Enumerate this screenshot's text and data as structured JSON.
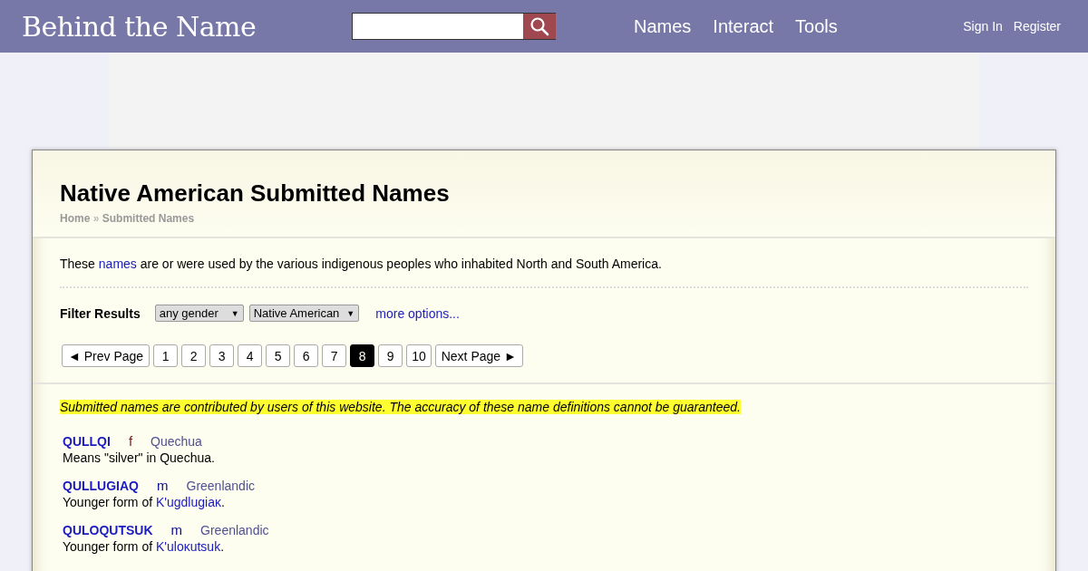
{
  "header": {
    "logo": "Behind the Name",
    "nav": [
      "Names",
      "Interact",
      "Tools"
    ],
    "account": [
      "Sign In",
      "Register"
    ]
  },
  "page": {
    "title": "Native American Submitted Names",
    "breadcrumb": [
      "Home",
      "Submitted Names"
    ],
    "breadcrumb_separator": "»",
    "intro": {
      "before": "These ",
      "link": "names",
      "after": " are or were used by the various indigenous peoples who inhabited North and South America."
    },
    "filter": {
      "label": "Filter Results",
      "selects": [
        {
          "value": "any gender",
          "caret": "▼"
        },
        {
          "value": "Native American",
          "caret": "▼"
        }
      ],
      "more": "more options..."
    },
    "pagination": [
      {
        "label": "◄ Prev Page",
        "kind": "prev",
        "selected": false
      },
      {
        "label": "1",
        "kind": "page",
        "selected": false
      },
      {
        "label": "2",
        "kind": "page",
        "selected": false
      },
      {
        "label": "3",
        "kind": "page",
        "selected": false
      },
      {
        "label": "4",
        "kind": "page",
        "selected": false
      },
      {
        "label": "5",
        "kind": "page",
        "selected": false
      },
      {
        "label": "6",
        "kind": "page",
        "selected": false
      },
      {
        "label": "7",
        "kind": "page",
        "selected": false
      },
      {
        "label": "8",
        "kind": "page",
        "selected": true
      },
      {
        "label": "9",
        "kind": "page",
        "selected": false
      },
      {
        "label": "10",
        "kind": "page",
        "selected": false
      },
      {
        "label": "Next Page ►",
        "kind": "next",
        "selected": false
      }
    ],
    "notice": "Submitted names are contributed by users of this website. The accuracy of these name definitions cannot be guaranteed.",
    "entries": [
      {
        "name": "QULLQI",
        "gender": "f",
        "color": "#802020",
        "usage": "Quechua",
        "description": {
          "before": "Means \"silver\" in Quechua."
        }
      },
      {
        "name": "QULLUGIAQ",
        "gender": "m",
        "color": "#0a0a8a",
        "usage": "Greenlandic",
        "description": {
          "before": "Younger form of ",
          "link": "K'ugdlugiaĸ",
          "after": "."
        }
      },
      {
        "name": "QULOQUTSUK",
        "gender": "m",
        "color": "#0a0a8a",
        "usage": "Greenlandic",
        "description": {
          "before": "Younger form of ",
          "link": "K'uloĸutsuk",
          "after": "."
        }
      }
    ]
  }
}
